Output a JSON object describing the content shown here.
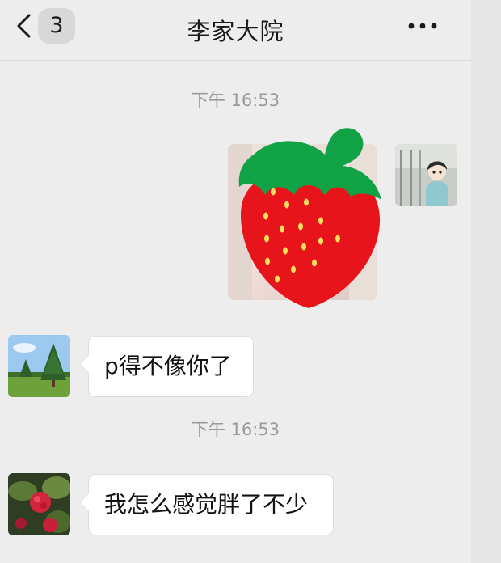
{
  "header": {
    "unread_count": "3",
    "title": "李家大院"
  },
  "messages": [
    {
      "type": "timestamp",
      "text": "下午 16:53"
    },
    {
      "type": "image",
      "sender": "self",
      "content": "photo covered by strawberry-sticker"
    },
    {
      "type": "text",
      "sender": "other",
      "text": "p得不像你了"
    },
    {
      "type": "timestamp",
      "text": "下午 16:53"
    },
    {
      "type": "text",
      "sender": "other",
      "text": "我怎么感觉胖了不少"
    }
  ],
  "colors": {
    "background": "#ededed",
    "bubble": "#ffffff",
    "timestamp": "#9a9a9a",
    "strawberry_red": "#e8141b",
    "strawberry_leaf": "#11a245",
    "seed": "#f3e05a"
  }
}
